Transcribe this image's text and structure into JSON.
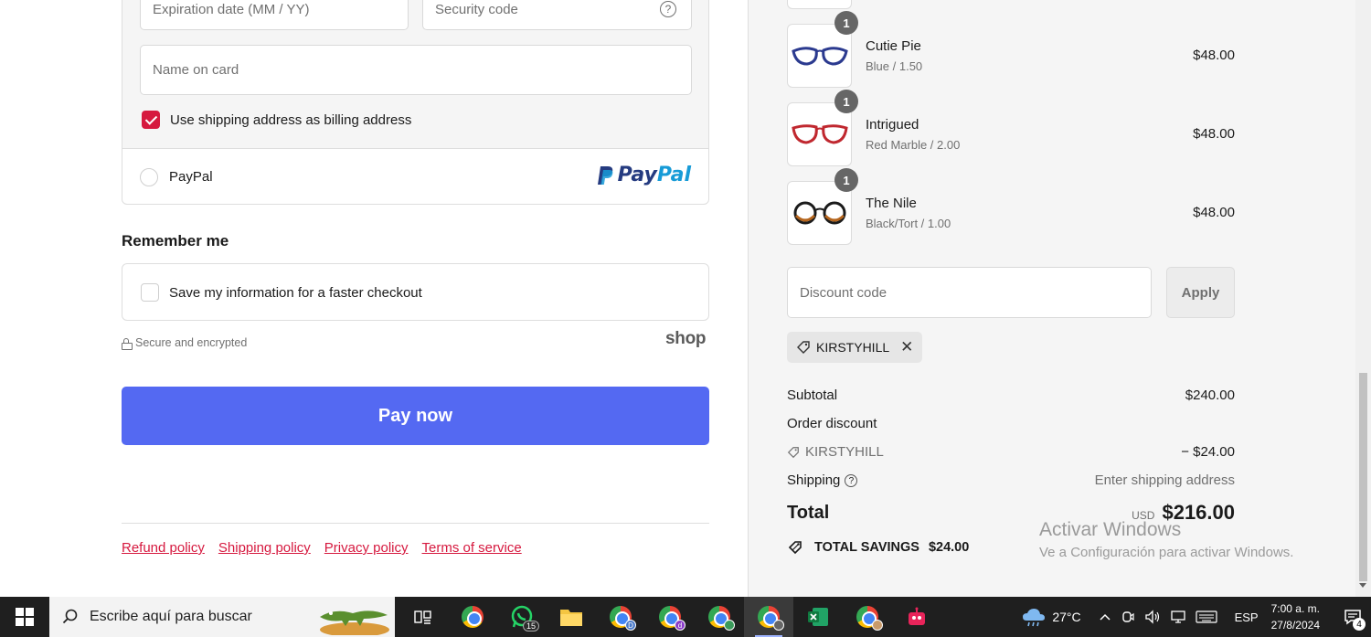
{
  "payment": {
    "expiration_placeholder": "Expiration date (MM / YY)",
    "security_placeholder": "Security code",
    "security_help": "?",
    "name_placeholder": "Name on card",
    "billing_same_label": "Use shipping address as billing address",
    "billing_same_checked": true,
    "paypal_label": "PayPal",
    "paypal_logo_pay": "Pay",
    "paypal_logo_pal": "Pal"
  },
  "remember": {
    "title": "Remember me",
    "save_label": "Save my information for a faster checkout",
    "shop_logo": "shop"
  },
  "secure_text": "Secure and encrypted",
  "pay_button": "Pay now",
  "policies": [
    "Refund policy",
    "Shipping policy",
    "Privacy policy",
    "Terms of service"
  ],
  "cart": {
    "items": [
      {
        "qty": "1",
        "name": "Cutie Pie",
        "variant": "Blue / 1.50",
        "price": "$48.00",
        "frame_color": "#2b3a8f"
      },
      {
        "qty": "1",
        "name": "Intrigued",
        "variant": "Red Marble / 2.00",
        "price": "$48.00",
        "frame_color": "#c0282f"
      },
      {
        "qty": "1",
        "name": "The Nile",
        "variant": "Black/Tort / 1.00",
        "price": "$48.00",
        "frame_color": "#1b1b1b"
      }
    ],
    "discount_placeholder": "Discount code",
    "apply_label": "Apply",
    "applied_code": "KIRSTYHILL",
    "subtotal_label": "Subtotal",
    "subtotal_value": "$240.00",
    "order_discount_label": "Order discount",
    "discount_code_label": "KIRSTYHILL",
    "discount_value": "− $24.00",
    "shipping_label": "Shipping",
    "shipping_help": "?",
    "shipping_value": "Enter shipping address",
    "total_label": "Total",
    "total_currency": "USD",
    "total_value": "$216.00",
    "savings_label": "TOTAL SAVINGS",
    "savings_value": "$24.00"
  },
  "watermark": {
    "line1": "Activar Windows",
    "line2": "Ve a Configuración para activar Windows."
  },
  "taskbar": {
    "search_placeholder": "Escribe aquí para buscar",
    "whatsapp_badge": "15",
    "temperature": "27°C",
    "language": "ESP",
    "time": "7:00 a. m.",
    "date": "27/8/2024",
    "notifications": "4"
  },
  "colors": {
    "accent": "#d6193f",
    "pay_button": "#5469f2",
    "taskbar": "#1f1f1f"
  }
}
